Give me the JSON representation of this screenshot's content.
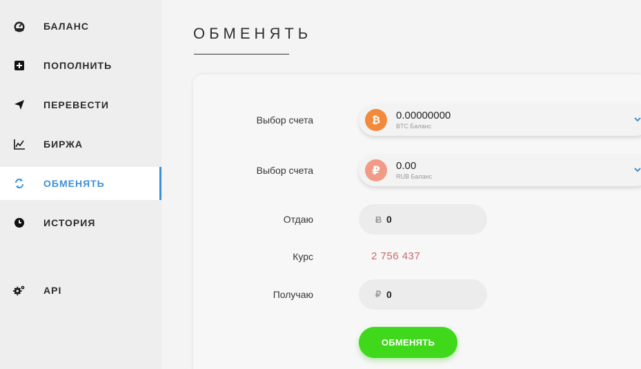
{
  "sidebar": {
    "items": [
      {
        "label": "БАЛАНС",
        "icon": "dashboard-icon"
      },
      {
        "label": "ПОПОЛНИТЬ",
        "icon": "plus-square-icon"
      },
      {
        "label": "ПЕРЕВЕСТИ",
        "icon": "send-icon"
      },
      {
        "label": "БИРЖА",
        "icon": "chart-icon"
      },
      {
        "label": "ОБМЕНЯТЬ",
        "icon": "exchange-icon",
        "active": true
      },
      {
        "label": "ИСТОРИЯ",
        "icon": "clock-icon"
      },
      {
        "label": "API",
        "icon": "gears-icon"
      }
    ],
    "accent_color": "#3d8fd6"
  },
  "main": {
    "title": "ОБМЕНЯТЬ",
    "form": {
      "from_account": {
        "label": "Выбор счета",
        "amount": "0.00000000",
        "caption": "BTC Баланс",
        "currency_symbol": "B",
        "coin_color": "#f28a3b"
      },
      "to_account": {
        "label": "Выбор счета",
        "amount": "0.00",
        "caption": "RUB Баланс",
        "currency_symbol": "₽",
        "coin_color": "#f19a86"
      },
      "give": {
        "label": "Отдаю",
        "currency": "Ƀ",
        "value": "0"
      },
      "rate": {
        "label": "Курс",
        "value": "2 756 437"
      },
      "receive": {
        "label": "Получаю",
        "currency": "₽",
        "value": "0"
      },
      "submit_label": "ОБМЕНЯТЬ",
      "submit_color": "#3fd81b"
    }
  }
}
